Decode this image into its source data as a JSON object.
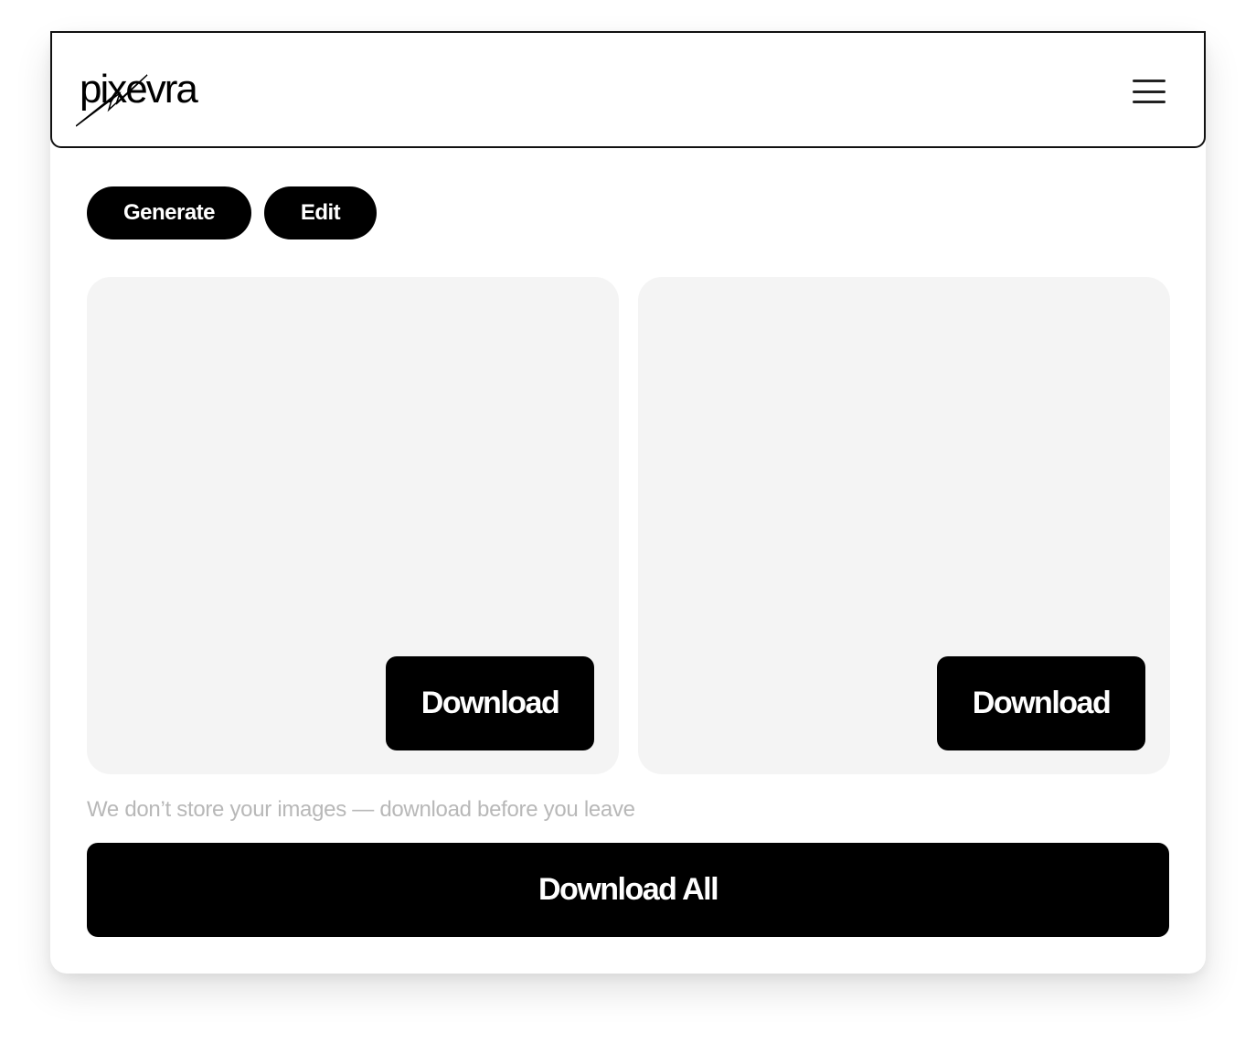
{
  "header": {
    "logo_text": "pixevra",
    "menu_icon": "hamburger-menu-icon"
  },
  "tabs": [
    {
      "label": "Generate"
    },
    {
      "label": "Edit"
    }
  ],
  "panels": [
    {
      "download_label": "Download"
    },
    {
      "download_label": "Download"
    }
  ],
  "notice": "We don’t store your images — download before you leave",
  "download_all_label": "Download All",
  "colors": {
    "button_bg": "#000000",
    "button_text": "#ffffff",
    "panel_bg": "#f4f4f4",
    "notice_text": "#b8b8b8"
  }
}
